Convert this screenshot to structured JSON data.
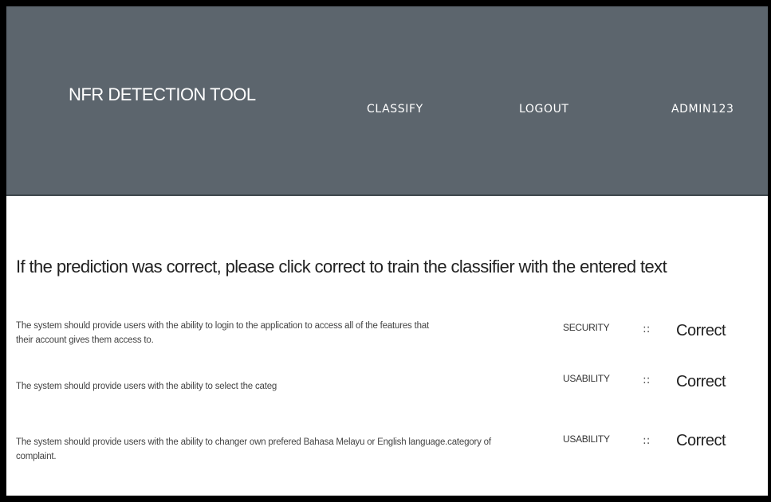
{
  "header": {
    "brand": "NFR DETECTION TOOL",
    "nav": {
      "classify": "CLASSIFY",
      "logout": "LOGOUT",
      "user": "ADMIN123"
    }
  },
  "main": {
    "instruction": "If the prediction was correct, please click correct to train the classifier with the entered text",
    "separator": "::",
    "rows": [
      {
        "text": "The system should provide users with the ability to login to the application to access all of the features that their account gives them access to.",
        "category": "SECURITY",
        "action": "Correct"
      },
      {
        "text": "The system should provide users with the ability to select the categ",
        "category": "USABILITY",
        "action": "Correct"
      },
      {
        "text": "The system should provide users  with the ability to changer own prefered Bahasa Melayu or English language.category of complaint.",
        "category": "USABILITY",
        "action": "Correct"
      }
    ]
  },
  "colors": {
    "navbar": "#5c656d",
    "frame": "#000000",
    "background": "#ffffff"
  }
}
